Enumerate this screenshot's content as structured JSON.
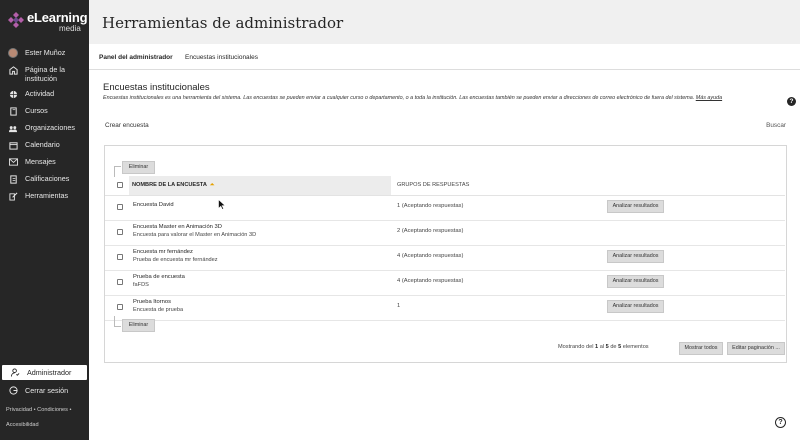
{
  "brand": {
    "name": "eLearning",
    "sub": "media"
  },
  "sidebar": {
    "items": [
      {
        "label": "Ester Muñoz",
        "icon": "avatar"
      },
      {
        "label": "Página de la institución",
        "icon": "institution-icon"
      },
      {
        "label": "Actividad",
        "icon": "globe-icon"
      },
      {
        "label": "Cursos",
        "icon": "book-icon"
      },
      {
        "label": "Organizaciones",
        "icon": "organizations-icon"
      },
      {
        "label": "Calendario",
        "icon": "calendar-icon"
      },
      {
        "label": "Mensajes",
        "icon": "mail-icon"
      },
      {
        "label": "Calificaciones",
        "icon": "grades-icon"
      },
      {
        "label": "Herramientas",
        "icon": "tools-icon"
      }
    ],
    "admin": {
      "label": "Administrador",
      "icon": "admin-icon"
    },
    "logout": {
      "label": "Cerrar sesión",
      "icon": "logout-icon"
    },
    "footer": {
      "line1": "Privacidad • Condiciones •",
      "line2": "Accesibilidad"
    }
  },
  "page": {
    "title": "Herramientas de administrador"
  },
  "tabs": [
    {
      "label": "Panel del administrador",
      "active": true
    },
    {
      "label": "Encuestas institucionales",
      "active": false
    }
  ],
  "section": {
    "title": "Encuestas institucionales",
    "description": "Encuestas institucionales es una herramienta del sistema. Las encuestas se pueden enviar a cualquier curso o departamento, o a toda la institución. Las encuestas también se pueden enviar a direcciones de correo electrónico de fuera del sistema.",
    "more_help": "Más ayuda"
  },
  "actions": {
    "create": "Crear encuesta",
    "search": "Buscar"
  },
  "table": {
    "delete_label": "Eliminar",
    "col_name": "NOMBRE DE LA ENCUESTA",
    "col_groups": "GRUPOS DE RESPUESTAS",
    "analyze_label": "Analizar resultados",
    "rows": [
      {
        "name": "Encuesta David",
        "desc": "",
        "groups": "1 (Aceptando respuestas)",
        "analyze": true
      },
      {
        "name": "Encuesta Master en Animación 3D",
        "desc": "Encuesta para valorar el Master en Animación 3D",
        "groups": "2 (Aceptando respuestas)",
        "analyze": false
      },
      {
        "name": "Encuesta mr fernández",
        "desc": "Prueba de encuesta mr fernández",
        "groups": "4 (Aceptando respuestas)",
        "analyze": true
      },
      {
        "name": "Prueba de encuesta",
        "desc": "faFDS",
        "groups": "4 (Aceptando respuestas)",
        "analyze": true
      },
      {
        "name": "Prueba Itornos",
        "desc": "Encuesta de prueba",
        "groups": "1",
        "analyze": true
      }
    ]
  },
  "pagination": {
    "prefix": "Mostrando del",
    "from": "1",
    "mid1": "al",
    "to": "5",
    "mid2": "de",
    "total": "5",
    "suffix": "elementos",
    "show_all": "Mostrar todos",
    "edit": "Editar paginación ..."
  },
  "colors": {
    "sidebar": "#262626",
    "header": "#f0f0f0",
    "accent": "#e5a100"
  }
}
